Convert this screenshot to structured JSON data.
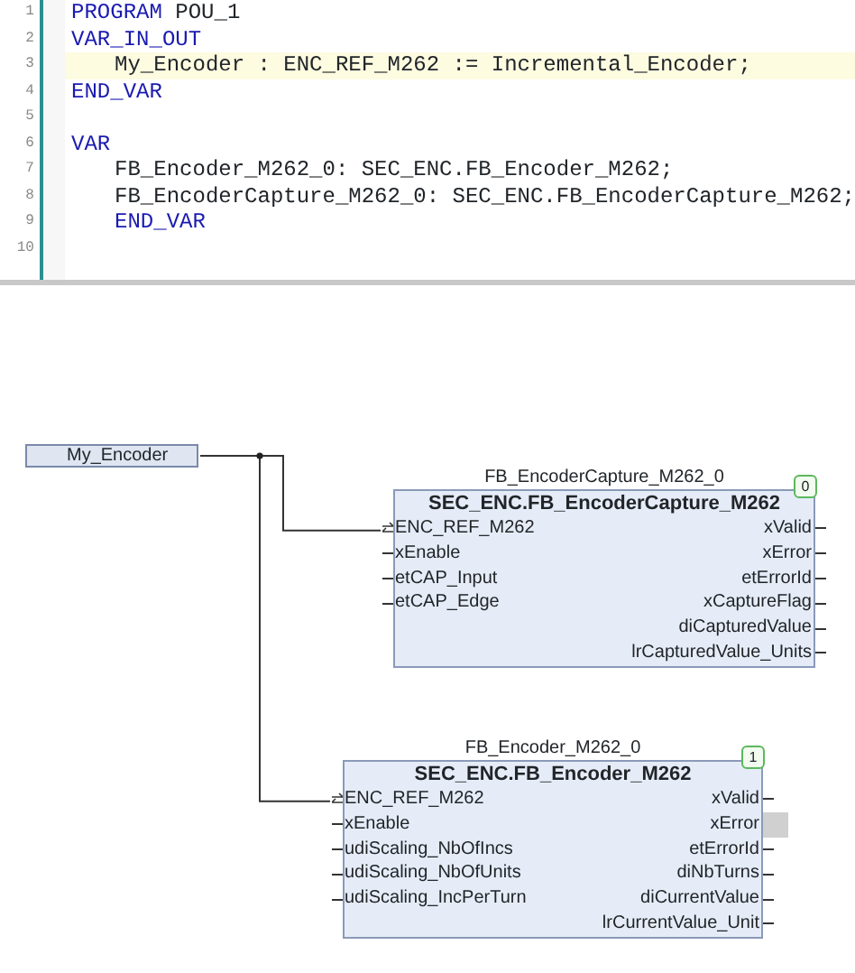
{
  "editor": {
    "lines": [
      {
        "number": "1",
        "highlighted": false,
        "indented": false,
        "tokens": [
          {
            "kind": "keyword",
            "text": "PROGRAM"
          },
          {
            "kind": "plain",
            "text": " POU_1"
          }
        ]
      },
      {
        "number": "2",
        "highlighted": false,
        "indented": false,
        "tokens": [
          {
            "kind": "keyword",
            "text": "VAR_IN_OUT"
          }
        ]
      },
      {
        "number": "3",
        "highlighted": true,
        "indented": true,
        "tokens": [
          {
            "kind": "plain",
            "text": "My_Encoder : ENC_REF_M262 := Incremental_Encoder;"
          }
        ]
      },
      {
        "number": "4",
        "highlighted": false,
        "indented": false,
        "tokens": [
          {
            "kind": "keyword",
            "text": "END_VAR"
          }
        ]
      },
      {
        "number": "5",
        "highlighted": false,
        "indented": false
      },
      {
        "number": "6",
        "highlighted": false,
        "indented": false,
        "tokens": [
          {
            "kind": "keyword",
            "text": "VAR"
          }
        ]
      },
      {
        "number": "7",
        "highlighted": false,
        "indented": true,
        "tokens": [
          {
            "kind": "plain",
            "text": "FB_Encoder_M262_0: SEC_ENC.FB_Encoder_M262;"
          }
        ]
      },
      {
        "number": "8",
        "highlighted": false,
        "indented": true,
        "tokens": [
          {
            "kind": "plain",
            "text": "FB_EncoderCapture_M262_0: SEC_ENC.FB_EncoderCapture_M262;"
          }
        ]
      },
      {
        "number": "9",
        "highlighted": false,
        "indented": true,
        "tokens": [
          {
            "kind": "keyword",
            "text": "END_VAR"
          }
        ]
      },
      {
        "number": "10",
        "highlighted": false,
        "indented": false
      }
    ]
  },
  "diagram": {
    "variable": "My_Encoder",
    "blocks": [
      {
        "instance": "FB_EncoderCapture_M262_0",
        "type": "SEC_ENC.FB_EncoderCapture_M262",
        "order": "0",
        "inputs": [
          {
            "name": "ENC_REF_M262",
            "kind": "inout"
          },
          {
            "name": "xEnable",
            "kind": "input"
          },
          {
            "name": "etCAP_Input",
            "kind": "input"
          },
          {
            "name": "etCAP_Edge",
            "kind": "input"
          }
        ],
        "outputs": [
          {
            "name": "xValid",
            "selected": false
          },
          {
            "name": "xError",
            "selected": false
          },
          {
            "name": "etErrorId",
            "selected": false
          },
          {
            "name": "xCaptureFlag",
            "selected": false
          },
          {
            "name": "diCapturedValue",
            "selected": false
          },
          {
            "name": "lrCapturedValue_Units",
            "selected": false
          }
        ]
      },
      {
        "instance": "FB_Encoder_M262_0",
        "type": "SEC_ENC.FB_Encoder_M262",
        "order": "1",
        "inputs": [
          {
            "name": "ENC_REF_M262",
            "kind": "inout"
          },
          {
            "name": "xEnable",
            "kind": "input"
          },
          {
            "name": "udiScaling_NbOfIncs",
            "kind": "input"
          },
          {
            "name": "udiScaling_NbOfUnits",
            "kind": "input"
          },
          {
            "name": "udiScaling_IncPerTurn",
            "kind": "input"
          }
        ],
        "outputs": [
          {
            "name": "xValid",
            "selected": false
          },
          {
            "name": "xError",
            "selected": true
          },
          {
            "name": "etErrorId",
            "selected": false
          },
          {
            "name": "diNbTurns",
            "selected": false
          },
          {
            "name": "diCurrentValue",
            "selected": false
          },
          {
            "name": "lrCurrentValue_Unit",
            "selected": false
          }
        ]
      }
    ]
  }
}
